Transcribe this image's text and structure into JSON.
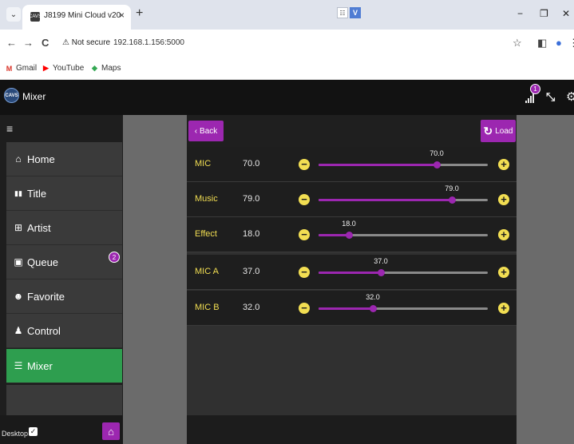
{
  "browser": {
    "tab_title": "J8199 Mini Cloud v20",
    "favicon_text": "CAVS",
    "tab_close": "×",
    "new_tab": "+",
    "ext_a": "☷",
    "ext_b": "V",
    "minimize": "−",
    "maximize": "❐",
    "close": "✕",
    "back": "←",
    "forward": "→",
    "reload": "C",
    "security": "Not secure",
    "url": "192.168.1.156:5000",
    "star": "☆",
    "sidepanel": "◧",
    "profile": "●",
    "more": "⋮",
    "bookmarks": [
      {
        "label": "Gmail",
        "icon": "M",
        "color": "#d93025"
      },
      {
        "label": "YouTube",
        "icon": "▶",
        "color": "#ff0000"
      },
      {
        "label": "Maps",
        "icon": "◆",
        "color": "#34a853"
      }
    ]
  },
  "app": {
    "logo_text": "CAVS",
    "title": "Mixer",
    "signal_badge": "1",
    "expand": "⤡",
    "gear": "⚙"
  },
  "sidebar": {
    "menu_icon": "≡",
    "items": [
      {
        "label": "Home",
        "icon": "⌂"
      },
      {
        "label": "Title",
        "icon": "▮▮"
      },
      {
        "label": "Artist",
        "icon": "⊞"
      },
      {
        "label": "Queue",
        "icon": "▣"
      },
      {
        "label": "Favorite",
        "icon": "☻"
      },
      {
        "label": "Control",
        "icon": "♟"
      },
      {
        "label": "Mixer",
        "icon": "☰"
      }
    ],
    "queue_badge": "2",
    "desktop_label": "Desktop",
    "desktop_checked": "✓",
    "home_button": "⌂"
  },
  "toolbar": {
    "back_label": "Back",
    "back_icon": "‹",
    "load_label": "Load",
    "load_icon": "↻"
  },
  "mixer": {
    "minus": "−",
    "plus": "+",
    "channels": [
      {
        "name": "MIC",
        "value": "70.0",
        "level": 0.7
      },
      {
        "name": "Music",
        "value": "79.0",
        "level": 0.79
      },
      {
        "name": "Effect",
        "value": "18.0",
        "level": 0.18
      },
      {
        "name": "MIC A",
        "value": "37.0",
        "level": 0.37
      },
      {
        "name": "MIC B",
        "value": "32.0",
        "level": 0.32
      }
    ]
  },
  "colors": {
    "accent": "#9c27b0",
    "active": "#2e9e4f",
    "label": "#f2de52"
  }
}
